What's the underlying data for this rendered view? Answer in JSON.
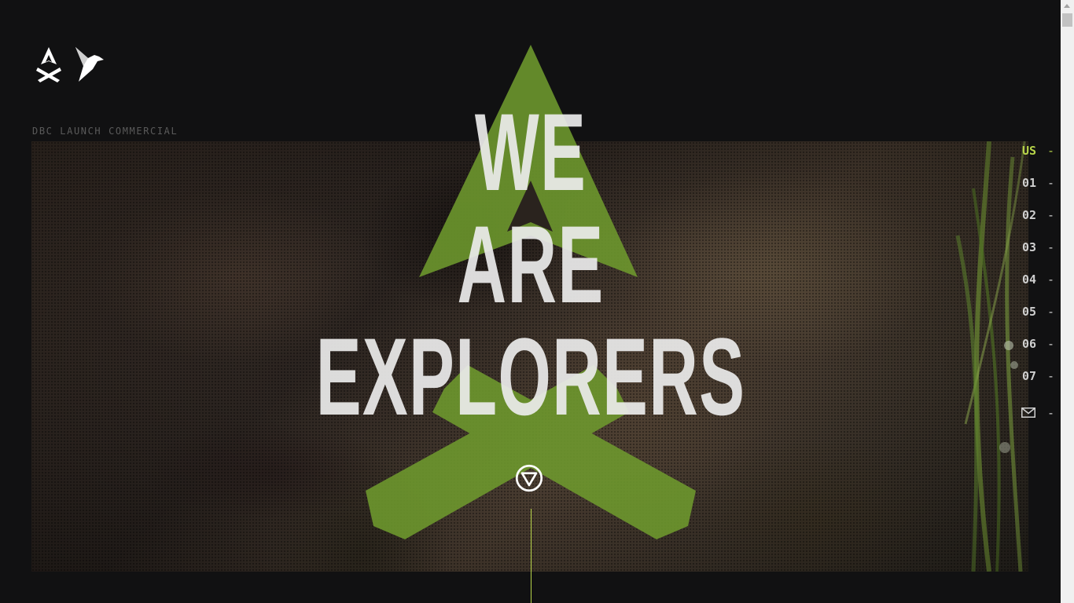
{
  "header": {
    "logos": [
      "campfire-logo",
      "origami-bird-logo"
    ]
  },
  "hero": {
    "caption": "DBC LAUNCH COMMERCIAL",
    "headline_lines": [
      "WE",
      "ARE",
      "EXPLORERS"
    ],
    "scroll_icon": "down-triangle-circle-icon"
  },
  "side_nav": {
    "items": [
      {
        "label": "US",
        "active": true
      },
      {
        "label": "01",
        "active": false
      },
      {
        "label": "02",
        "active": false
      },
      {
        "label": "03",
        "active": false
      },
      {
        "label": "04",
        "active": false
      },
      {
        "label": "05",
        "active": false
      },
      {
        "label": "06",
        "active": false
      },
      {
        "label": "07",
        "active": false
      }
    ],
    "dash": "-",
    "mail_icon": "envelope-icon"
  },
  "colors": {
    "background": "#111112",
    "accent": "#b7d44a",
    "symbol_green": "#6f9a2e",
    "headline": "#ebebeb",
    "nav_text": "#cfcfcf"
  }
}
